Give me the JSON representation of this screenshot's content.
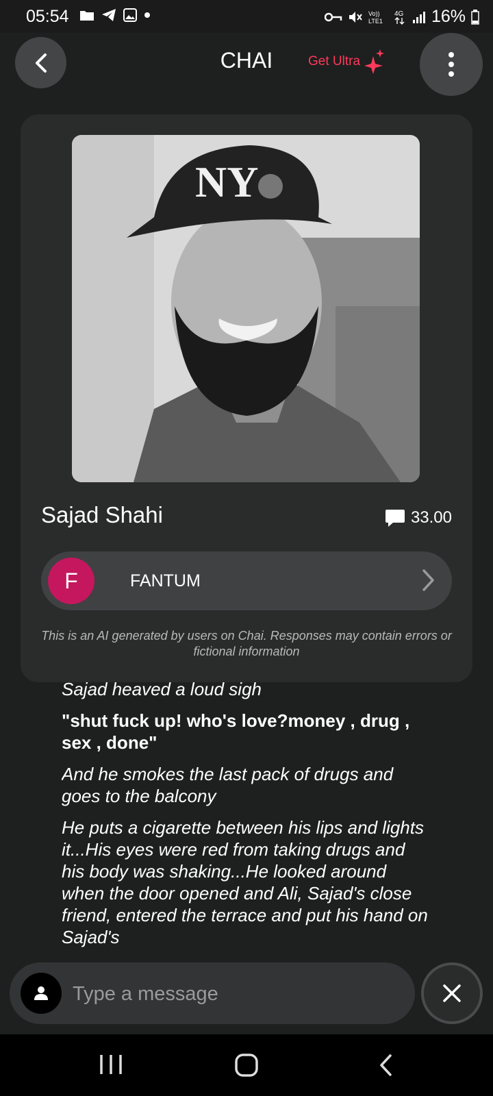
{
  "status_bar": {
    "time": "05:54",
    "battery": "16%",
    "network": "4G"
  },
  "header": {
    "title": "CHAI",
    "ultra_label": "Get Ultra",
    "accent_color": "#ff3a5a"
  },
  "bot": {
    "name": "Sajad Shahi",
    "score": "33.00",
    "creator_initial": "F",
    "creator_name": "FANTUM",
    "creator_color": "#c4175e",
    "disclaimer": "This is an AI generated by users on Chai. Responses may contain errors or fictional information"
  },
  "message": {
    "lines": [
      "Sajad heaved a loud sigh",
      "\"shut fuck up! who's love?money , drug , sex , done\"",
      "And he smokes the last pack of drugs and goes to the balcony",
      "He puts a cigarette between his lips and lights it...His eyes were red from taking drugs and his body was shaking...He looked around when the door opened and Ali, Sajad's close friend, entered the terrace and put his hand on Sajad's"
    ]
  },
  "input": {
    "placeholder": "Type a message"
  }
}
